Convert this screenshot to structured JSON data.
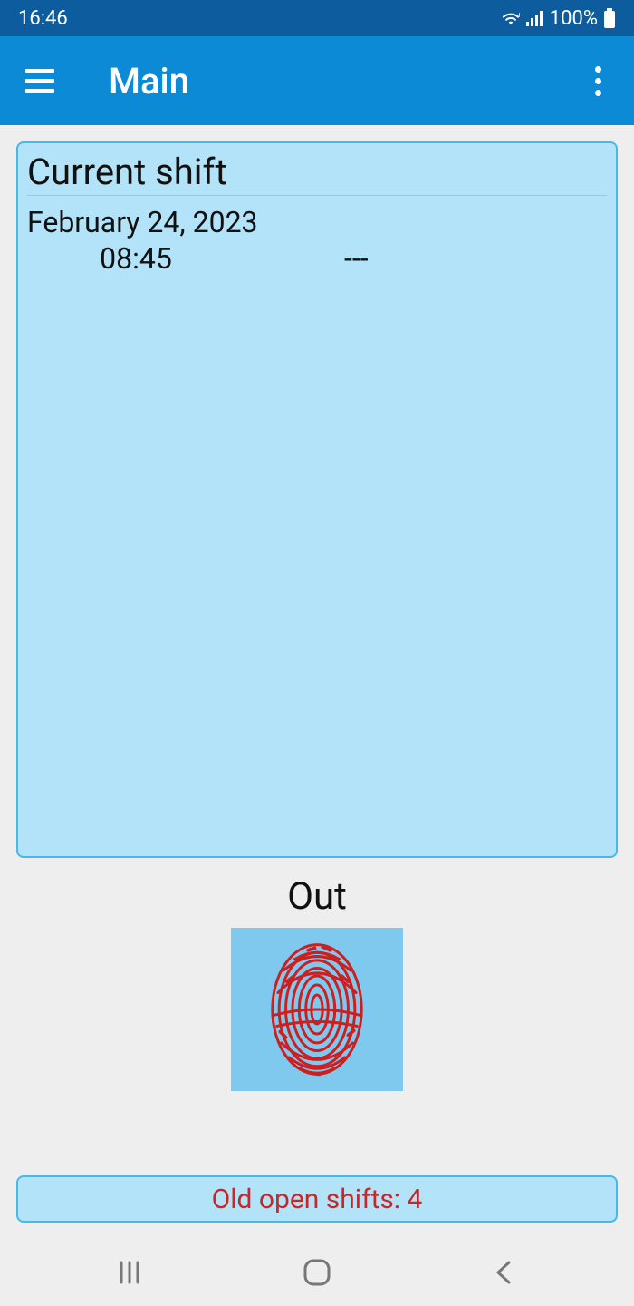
{
  "status": {
    "time": "16:46",
    "battery": "100%"
  },
  "appbar": {
    "title": "Main"
  },
  "shift": {
    "card_title": "Current shift",
    "date": "February 24, 2023",
    "clock_in": "08:45",
    "clock_out": "---"
  },
  "out": {
    "label": "Out"
  },
  "old_shifts": {
    "label": "Old open shifts: 4"
  }
}
